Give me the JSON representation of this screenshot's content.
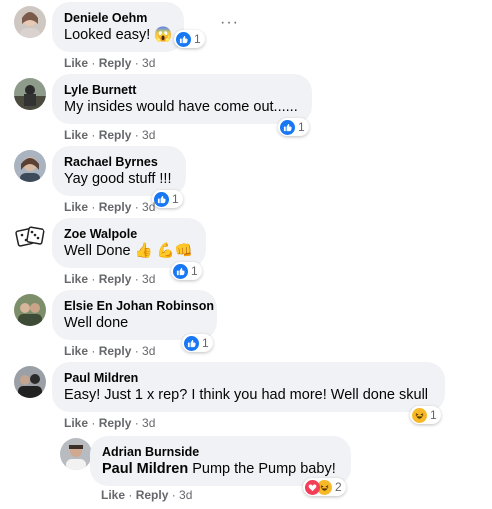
{
  "colors": {
    "like_blue": "#1877f2",
    "haha_yellow": "#f7b928",
    "love_red": "#f33e58",
    "meta_gray": "#65676b",
    "bubble_bg": "#f0f2f5"
  },
  "action_like": "Like",
  "action_reply": "Reply",
  "comments": [
    {
      "author": "Deniele Oehm",
      "text": "Looked easy! 😱",
      "age": "3d",
      "reaction_count": "1",
      "reaction": "like-icon"
    },
    {
      "author": "Lyle Burnett",
      "text": "My insides would have come out......",
      "age": "3d",
      "reaction_count": "1",
      "reaction": "like-icon"
    },
    {
      "author": "Rachael Byrnes",
      "text": "Yay good stuff !!!",
      "age": "3d",
      "reaction_count": "1",
      "reaction": "like-icon"
    },
    {
      "author": "Zoe Walpole",
      "text": "Well Done 👍 💪👊",
      "age": "3d",
      "reaction_count": "1",
      "reaction": "like-icon"
    },
    {
      "author": "Elsie En Johan Robinson",
      "text": "Well done",
      "age": "3d",
      "reaction_count": "1",
      "reaction": "like-icon"
    },
    {
      "author": "Paul Mildren",
      "text": "Easy! Just 1 x rep? I think you had more! Well done skull",
      "age": "3d",
      "reaction_count": "1",
      "reaction": "haha-icon"
    },
    {
      "author": "Adrian Burnside",
      "mention": "Paul Mildren",
      "text": " Pump the Pump baby!",
      "age": "3d",
      "reaction_count": "2",
      "reaction": "love-haha-icons"
    }
  ]
}
